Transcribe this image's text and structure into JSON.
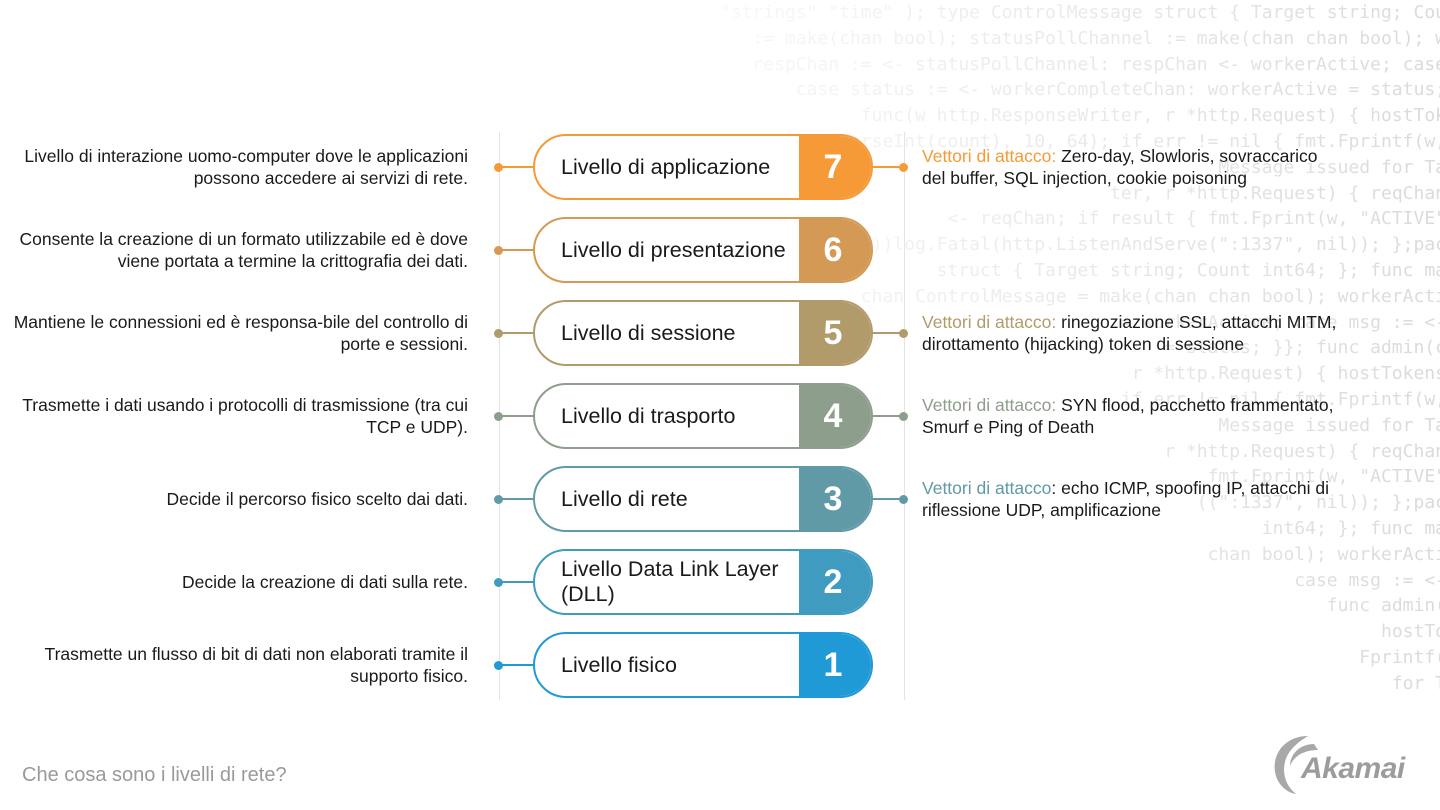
{
  "background_code": [
    "          \"strings\" \"time\" ); type ControlMessage struct { Target string; Cou",
    "             := make(chan bool); statusPollChannel := make(chan chan bool); w",
    "     respChan := <- statusPollChannel: respChan <- workerActive; case",
    "       case status := <- workerCompleteChan: workerActive = status;",
    "     func(w http.ResponseWriter, r *http.Request) { hostTok",
    "  ParseInt(count), 10, 64); if err != nil { fmt.Fprintf(w,",
    "                                   Message issued for Ta",
    "                 ter, r *http.Request) { reqChan",
    "  <- reqChan; if result { fmt.Fprint(w, \"ACTIVE\"",
    "  nil))log.Fatal(http.ListenAndServe(\":1337\", nil)); };pac",
    "  struct { Target string; Count int64; }; func ma",
    "  chan ControlMessage = make(chan chan bool); workerActi",
    "                       := workerActive; case msg := <-",
    "                  = status; }}; func admin(c",
    "            r *http.Request) { hostTokens",
    "              if err != nil { fmt.Fprintf(w,",
    "                       Message issued for Ta",
    "                r *http.Request) { reqChan",
    "                 fmt.Fprint(w, \"ACTIVE\"",
    "                    ((\":1337\", nil)); };pac",
    "                     int64; }; func ma",
    "                 chan bool); workerActi",
    "                    case msg := <-",
    "                     func admin(",
    "                          hostTo",
    "                        Fprintf(",
    "                         for T"
  ],
  "layers": [
    {
      "number": "7",
      "name": "Livello di applicazione",
      "description": "Livello di interazione uomo-computer dove le applicazioni possono accedere ai servizi di rete.",
      "color": "#f59a36",
      "attack_label": "Vettori di attacco:",
      "attack_text": " Zero-day, Slowloris, sovraccarico del buffer, SQL injection, cookie poisoning"
    },
    {
      "number": "6",
      "name": "Livello di presentazione",
      "description": "Consente la creazione di un formato utilizzabile ed è dove viene portata a termine la crittografia dei dati.",
      "color": "#d49a55",
      "attack_label": null,
      "attack_text": null
    },
    {
      "number": "5",
      "name": "Livello di sessione",
      "description": "Mantiene le connessioni ed è responsa-bile del controllo di porte e sessioni.",
      "color": "#b29b6b",
      "attack_label": "Vettori di attacco:",
      "attack_text": " rinegoziazione SSL, attacchi MITM, dirottamento (hijacking) token di sessione"
    },
    {
      "number": "4",
      "name": "Livello di trasporto",
      "description": "Trasmette i dati usando i protocolli di trasmissione (tra cui TCP e UDP).",
      "color": "#8e9e8c",
      "attack_label": "Vettori di attacco:",
      "attack_text": " SYN flood, pacchetto frammentato, Smurf e Ping of Death"
    },
    {
      "number": "3",
      "name": "Livello di rete",
      "description": "Decide il percorso fisico scelto dai dati.",
      "color": "#5f9aa6",
      "attack_label": "Vettori di attacco",
      "attack_text": ": echo ICMP, spoofing IP, attacchi di riflessione UDP, amplificazione"
    },
    {
      "number": "2",
      "name": "Livello Data Link Layer (DLL)",
      "description": "Decide la creazione di dati sulla rete.",
      "color": "#3f9cc0",
      "attack_label": null,
      "attack_text": null
    },
    {
      "number": "1",
      "name": "Livello fisico",
      "description": "Trasmette un flusso di bit di dati non elaborati tramite il supporto fisico.",
      "color": "#1f9ad6",
      "attack_label": null,
      "attack_text": null
    }
  ],
  "footer": {
    "title": "Che cosa sono i livelli di rete?",
    "logo_text": "Akamai"
  }
}
